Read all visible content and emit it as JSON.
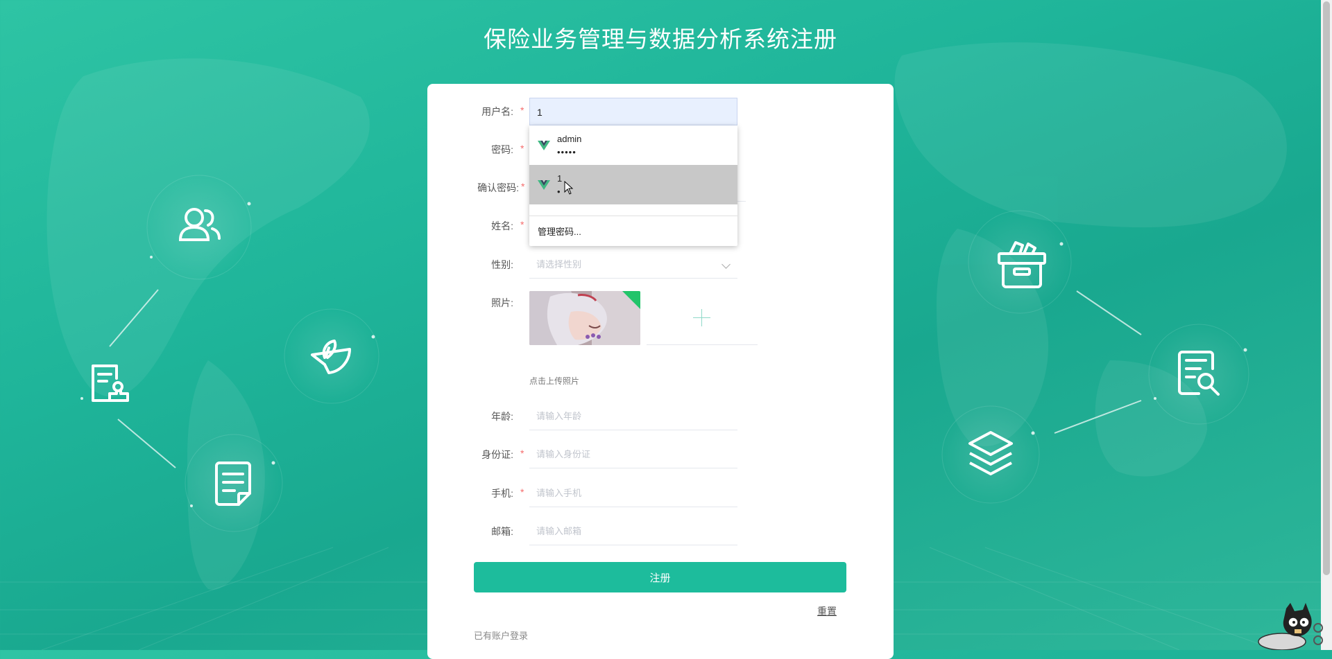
{
  "page": {
    "title": "保险业务管理与数据分析系统注册"
  },
  "form": {
    "username": {
      "label": "用户名:",
      "value": "1",
      "required": true
    },
    "password": {
      "label": "密码:",
      "required": true
    },
    "confirm_password": {
      "label": "确认密码:",
      "required": true
    },
    "name": {
      "label": "姓名:",
      "required": true
    },
    "gender": {
      "label": "性别:",
      "placeholder": "请选择性别"
    },
    "photo": {
      "label": "照片:",
      "tip": "点击上传照片"
    },
    "age": {
      "label": "年龄:",
      "placeholder": "请输入年龄"
    },
    "id_card": {
      "label": "身份证:",
      "placeholder": "请输入身份证",
      "required": true
    },
    "phone": {
      "label": "手机:",
      "placeholder": "请输入手机",
      "required": true
    },
    "email": {
      "label": "邮箱:",
      "placeholder": "请输入邮箱"
    },
    "submit_label": "注册",
    "reset_label": "重置",
    "login_link": "已有账户登录",
    "required_mark": "*"
  },
  "autofill": {
    "items": [
      {
        "username": "admin",
        "password_mask": "•••••"
      },
      {
        "username": "1",
        "password_mask": "•"
      }
    ],
    "manage_label": "管理密码..."
  },
  "colors": {
    "primary": "#1dbc9c",
    "background": "#23b89a",
    "required": "#f56c6c",
    "autofill_bg": "#e8f0fe"
  },
  "icons": [
    "users-icon",
    "document-stamp-icon",
    "hand-leaf-icon",
    "document-icon",
    "archive-box-icon",
    "document-search-icon",
    "layers-icon",
    "vue-logo-icon"
  ]
}
